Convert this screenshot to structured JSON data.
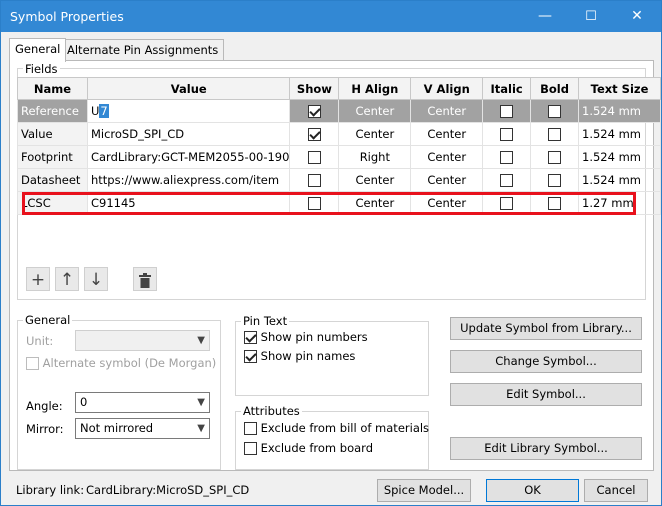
{
  "window": {
    "title": "Symbol Properties",
    "minimize": "—",
    "maximize": "☐",
    "close": "✕"
  },
  "tabs": [
    {
      "label": "General"
    },
    {
      "label": "Alternate Pin Assignments"
    }
  ],
  "fields": {
    "group_label": "Fields",
    "columns": [
      "Name",
      "Value",
      "Show",
      "H Align",
      "V Align",
      "Italic",
      "Bold",
      "Text Size"
    ],
    "rows": [
      {
        "name": "Reference",
        "value_prefix": "U",
        "value_selected": "7",
        "show": true,
        "halign": "Center",
        "valign": "Center",
        "italic": false,
        "bold": false,
        "size": "1.524 mm"
      },
      {
        "name": "Value",
        "value": "MicroSD_SPI_CD",
        "show": true,
        "halign": "Center",
        "valign": "Center",
        "italic": false,
        "bold": false,
        "size": "1.524 mm"
      },
      {
        "name": "Footprint",
        "value": "CardLibrary:GCT-MEM2055-00-190",
        "show": false,
        "halign": "Right",
        "valign": "Center",
        "italic": false,
        "bold": false,
        "size": "1.524 mm"
      },
      {
        "name": "Datasheet",
        "value": "https://www.aliexpress.com/item",
        "show": false,
        "halign": "Center",
        "valign": "Center",
        "italic": false,
        "bold": false,
        "size": "1.524 mm"
      },
      {
        "name": "LCSC",
        "value": "C91145",
        "show": false,
        "halign": "Center",
        "valign": "Center",
        "italic": false,
        "bold": false,
        "size": "1.27 mm"
      }
    ]
  },
  "general": {
    "group_label": "General",
    "unit_label": "Unit:",
    "alt_symbol_label": "Alternate symbol (De Morgan)",
    "angle_label": "Angle:",
    "angle_value": "0",
    "mirror_label": "Mirror:",
    "mirror_value": "Not mirrored"
  },
  "pin_text": {
    "group_label": "Pin Text",
    "show_numbers": "Show pin numbers",
    "show_names": "Show pin names"
  },
  "attributes": {
    "group_label": "Attributes",
    "exclude_bom": "Exclude from bill of materials",
    "exclude_board": "Exclude from board"
  },
  "actions": {
    "update": "Update Symbol from Library...",
    "change": "Change Symbol...",
    "edit": "Edit Symbol...",
    "edit_lib": "Edit Library Symbol..."
  },
  "footer": {
    "library_link_label": "Library link:",
    "library_link_value": "CardLibrary:MicroSD_SPI_CD",
    "spice": "Spice Model...",
    "ok": "OK",
    "cancel": "Cancel"
  },
  "colors": {
    "titlebar": "#3288d4",
    "highlight": "#e8111c",
    "selected_row": "#a2a2a2"
  }
}
